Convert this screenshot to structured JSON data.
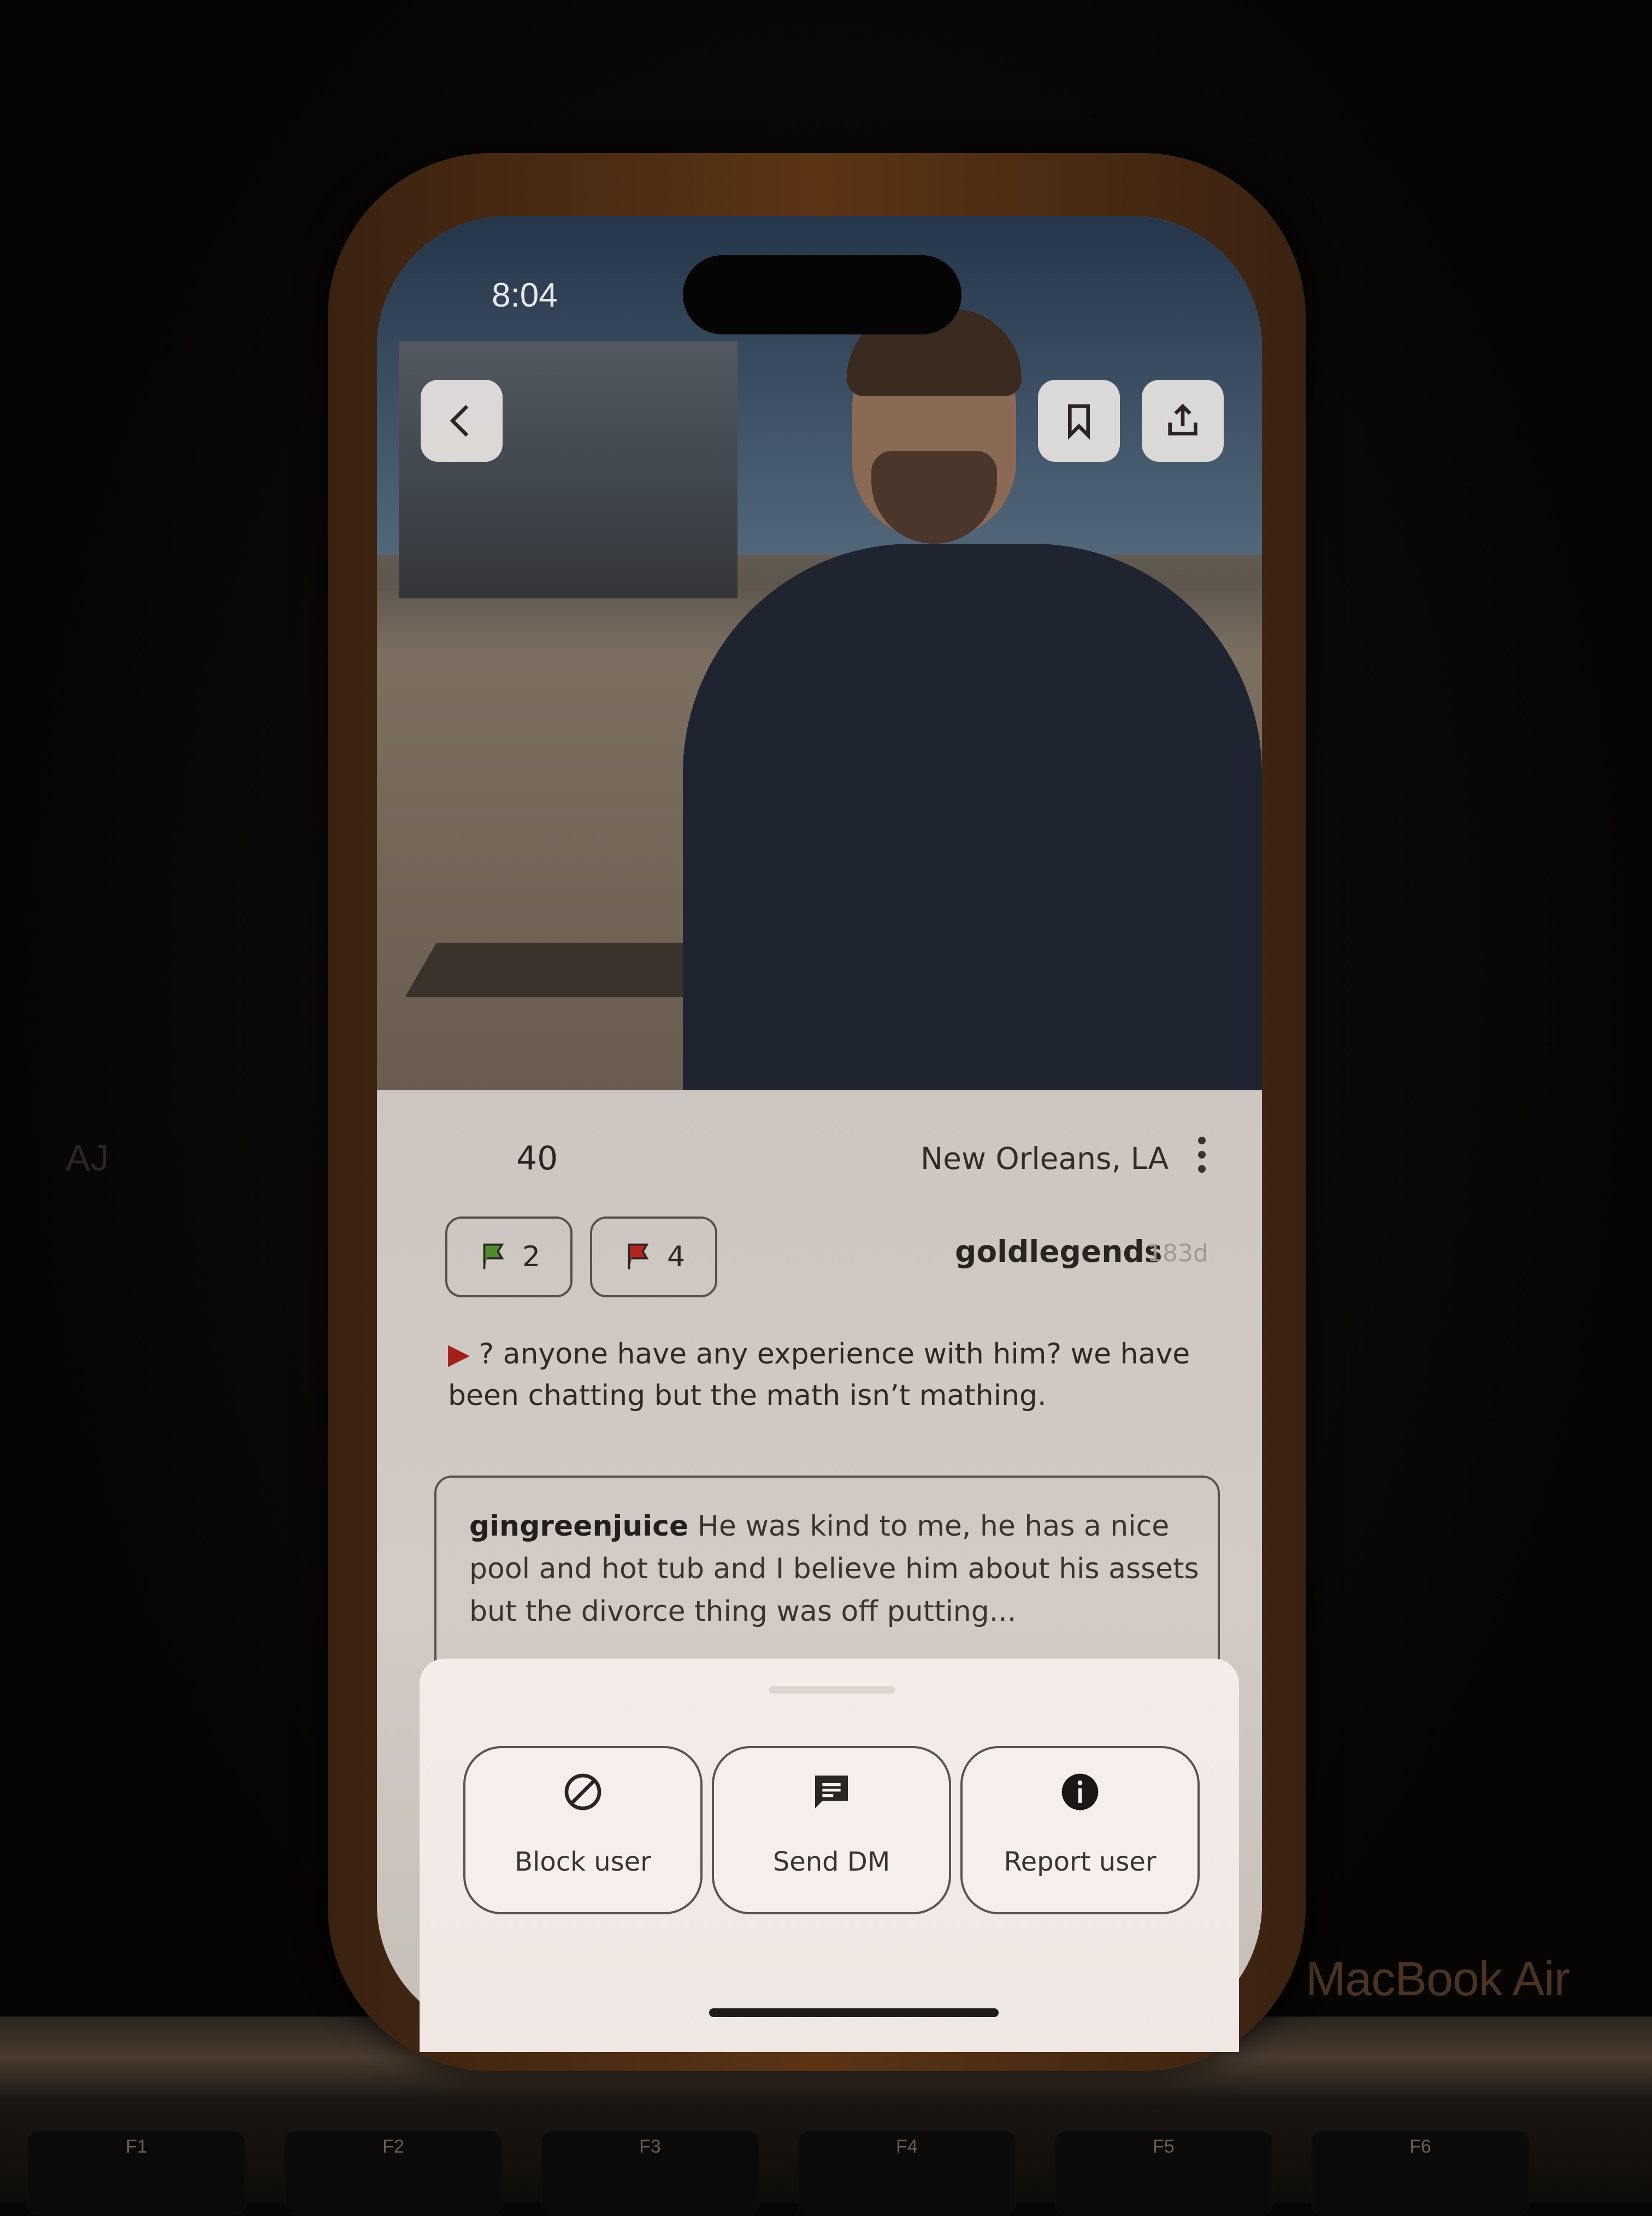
{
  "status_bar": {
    "time": "8:04"
  },
  "toolbar": {
    "back_icon": "chevron-left-icon",
    "bookmark_icon": "bookmark-icon",
    "share_icon": "share-icon"
  },
  "profile": {
    "name": "AJ",
    "age": "40",
    "location": "New Orleans, LA",
    "green_flags": "2",
    "red_flags": "4",
    "poster": "goldlegends",
    "post_age": "183d",
    "post_text": "? anyone have any experience with him? we have been chatting but the math isn’t mathing."
  },
  "comment": {
    "user": "gingreenjuice",
    "text": "He was kind to me, he has a nice pool and hot tub and I believe him about his assets but the divorce thing was off putting..."
  },
  "actions": {
    "block_label": "Block user",
    "dm_label": "Send DM",
    "report_label": "Report user"
  },
  "device": {
    "laptop_brand": "MacBook Air",
    "fkeys": [
      "F1",
      "F2",
      "F3",
      "F4",
      "F5",
      "F6"
    ]
  },
  "colors": {
    "green_flag": "#4f8a2c",
    "red_flag": "#b3261e"
  }
}
